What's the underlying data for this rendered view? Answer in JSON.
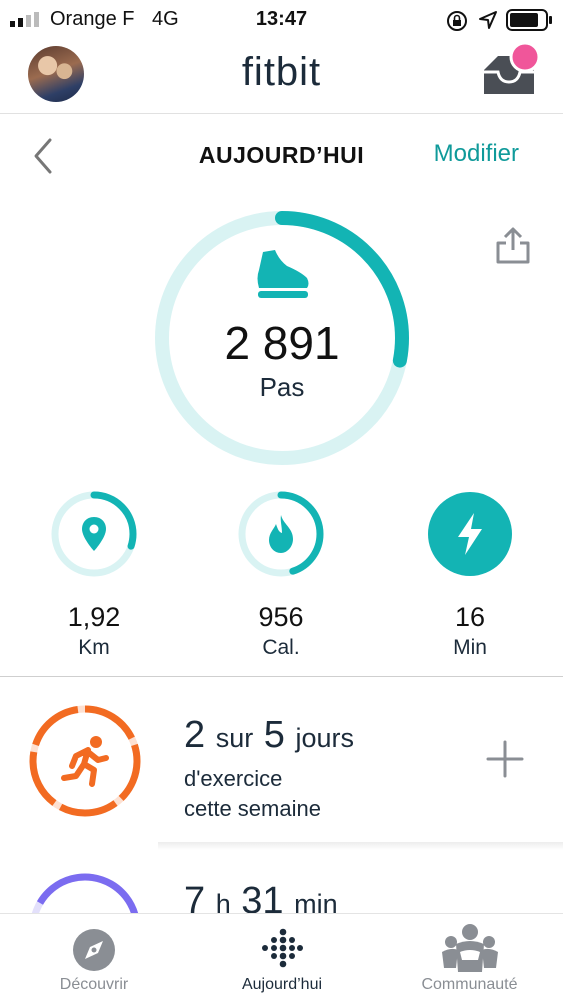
{
  "status_bar": {
    "carrier": "Orange F",
    "network": "4G",
    "time": "13:47"
  },
  "header": {
    "app_name": "fitbit"
  },
  "day_nav": {
    "title": "AUJOURD’HUI",
    "edit_label": "Modifier"
  },
  "steps": {
    "value": "2 891",
    "label": "Pas",
    "progress": 0.28
  },
  "stats": [
    {
      "value": "1,92",
      "unit": "Km",
      "icon": "location-pin-icon",
      "progress": 0.3
    },
    {
      "value": "956",
      "unit": "Cal.",
      "icon": "flame-icon",
      "progress": 0.45
    },
    {
      "value": "16",
      "unit": "Min",
      "icon": "lightning-icon",
      "progress": 1.0
    }
  ],
  "exercise": {
    "done": "2",
    "sur": "sur",
    "total": "5",
    "unit": "jours",
    "line1": "d'exercice",
    "line2": "cette semaine"
  },
  "sleep": {
    "hours": "7",
    "h": "h",
    "minutes": "31",
    "min": "min"
  },
  "tabs": [
    {
      "label": "Découvrir",
      "icon": "compass-icon"
    },
    {
      "label": "Aujourd’hui",
      "icon": "fitbit-dots-icon"
    },
    {
      "label": "Communauté",
      "icon": "community-icon"
    }
  ],
  "colors": {
    "teal": "#13b4b4",
    "teal_light": "#d9f3f3",
    "orange": "#f26b22",
    "orange_light": "#fde0d1",
    "purple": "#7b6cf0",
    "notification": "#f0569a",
    "link": "#0f9a9a"
  }
}
